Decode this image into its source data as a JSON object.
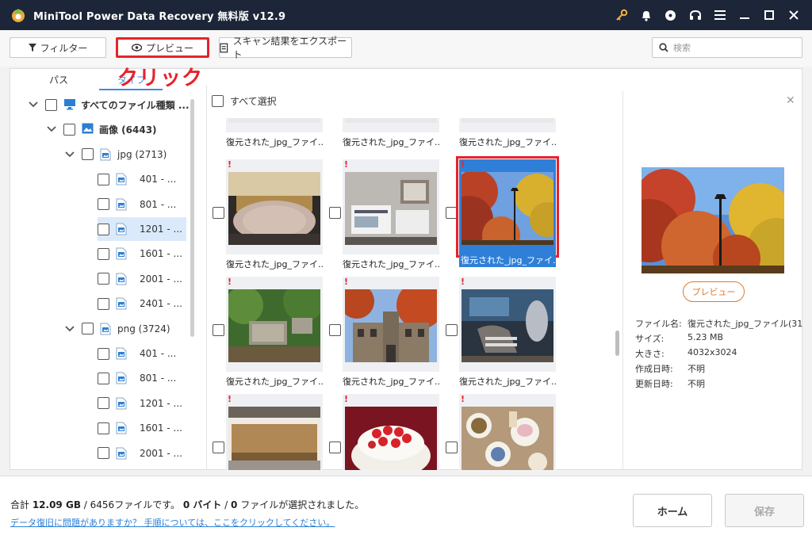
{
  "window": {
    "title": "MiniTool Power Data Recovery 無料版 v12.9",
    "title_icons": [
      "key-icon",
      "bell-icon",
      "disc-icon",
      "headset-icon",
      "menu-icon",
      "minimize-icon",
      "maximize-icon",
      "close-icon"
    ]
  },
  "toolbar": {
    "filter_label": "フィルター",
    "preview_label": "プレビュー",
    "export_label": "スキャン結果をエクスポート",
    "search_placeholder": "検索"
  },
  "annotation": "クリック",
  "tabs": {
    "path": "パス",
    "type": "タイプ"
  },
  "tree": [
    {
      "label": "すべてのファイル種類 ...",
      "bold": true,
      "level": 0,
      "expanded": true,
      "icon": "monitor-icon"
    },
    {
      "label": "画像 (6443)",
      "bold": true,
      "level": 1,
      "expanded": true,
      "icon": "image-icon"
    },
    {
      "label": "jpg (2713)",
      "bold": false,
      "level": 2,
      "expanded": true,
      "icon": "file-icon"
    },
    {
      "label": "401 - ...",
      "level": 3,
      "icon": "file-icon"
    },
    {
      "label": "801 - ...",
      "level": 3,
      "icon": "file-icon"
    },
    {
      "label": "1201 - ...",
      "level": 3,
      "icon": "file-icon",
      "selected": true
    },
    {
      "label": "1601 - ...",
      "level": 3,
      "icon": "file-icon"
    },
    {
      "label": "2001 - ...",
      "level": 3,
      "icon": "file-icon"
    },
    {
      "label": "2401 - ...",
      "level": 3,
      "icon": "file-icon"
    },
    {
      "label": "png (3724)",
      "bold": false,
      "level": 2,
      "expanded": true,
      "icon": "file-icon"
    },
    {
      "label": "401 - ...",
      "level": 3,
      "icon": "file-icon"
    },
    {
      "label": "801 - ...",
      "level": 3,
      "icon": "file-icon"
    },
    {
      "label": "1201 - ...",
      "level": 3,
      "icon": "file-icon"
    },
    {
      "label": "1601 - ...",
      "level": 3,
      "icon": "file-icon"
    },
    {
      "label": "2001 - ...",
      "level": 3,
      "icon": "file-icon"
    }
  ],
  "grid": {
    "select_all_label": "すべて選択",
    "items": [
      {
        "caption": "復元された_jpg_ファイ...",
        "thumb": "top-crop-a"
      },
      {
        "caption": "復元された_jpg_ファイ...",
        "thumb": "top-crop-b"
      },
      {
        "caption": "復元された_jpg_ファイ...",
        "thumb": "top-crop-c"
      },
      {
        "caption": "復元された_jpg_ファイ...",
        "thumb": "stage-crowd"
      },
      {
        "caption": "復元された_jpg_ファイ...",
        "thumb": "exhibit-table"
      },
      {
        "caption": "復元された_jpg_ファイ...",
        "thumb": "autumn-tree",
        "selected": true
      },
      {
        "caption": "復元された_jpg_ファイ...",
        "thumb": "garden-sign"
      },
      {
        "caption": "復元された_jpg_ファイ...",
        "thumb": "old-building"
      },
      {
        "caption": "復元された_jpg_ファイ...",
        "thumb": "fossil-museum"
      },
      {
        "caption": "",
        "thumb": "wooden-table"
      },
      {
        "caption": "",
        "thumb": "strawberry-cake"
      },
      {
        "caption": "",
        "thumb": "dinner-table"
      }
    ]
  },
  "preview": {
    "button_label": "プレビュー",
    "meta": [
      {
        "key": "ファイル名:",
        "value": "復元された_jpg_ファイル(31"
      },
      {
        "key": "サイズ:",
        "value": "5.23 MB"
      },
      {
        "key": "大きさ:",
        "value": "4032x3024"
      },
      {
        "key": "作成日時:",
        "value": "不明"
      },
      {
        "key": "更新日時:",
        "value": "不明"
      }
    ]
  },
  "footer": {
    "summary_prefix": "合計 ",
    "total_size": "12.09 GB",
    "total_files": "6456",
    "summary_files_suffix": "ファイルです。",
    "selected_size": "0 バイト",
    "selected_sep": " / ",
    "selected_count": "0",
    "selected_suffix": " ファイルが選択されました。",
    "help_link": "データ復旧に問題がありますか？ 手順については、ここをクリックしてください。",
    "home_label": "ホーム",
    "save_label": "保存"
  },
  "colors": {
    "titlebar": "#1d2538",
    "accent": "#3d8de0",
    "highlight": "#e6222c",
    "preview_orange": "#e07a2c"
  }
}
